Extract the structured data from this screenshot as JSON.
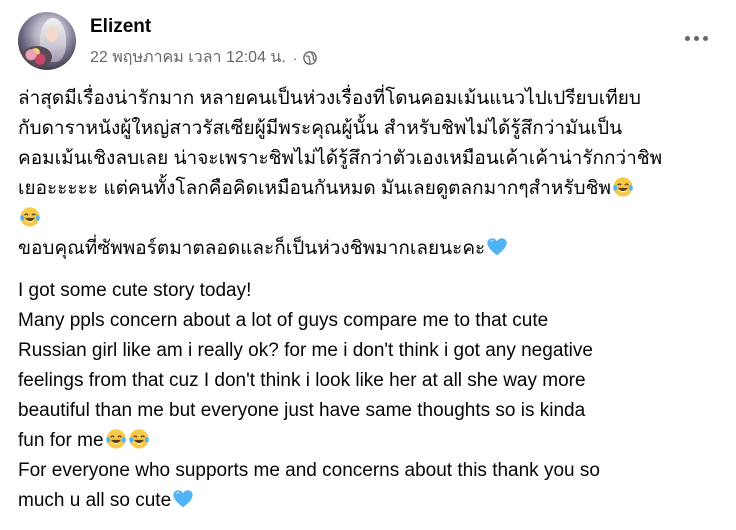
{
  "post": {
    "author": "Elizent",
    "timestamp": "22 พฤษภาคม เวลา 12:04 น.",
    "separator": "·",
    "privacy_icon": "globe-icon",
    "more_icon": "more-horizontal-icon"
  },
  "body": {
    "thai_lines": [
      "ล่าสุดมีเรื่องน่ารักมาก หลายคนเป็นห่วงเรื่องที่โดนคอมเม้นแนวไปเปรียบเทียบ",
      "กับดาราหนังผู้ใหญ่สาวรัสเซียผู้มีพระคุณผู้นั้น สำหรับชิพไม่ได้รู้สึกว่ามันเป็น",
      "คอมเม้นเชิงลบเลย น่าจะเพราะชิพไม่ได้รู้สึกว่าตัวเองเหมือนเค้าเค้าน่ารักกว่าชิพ",
      "เยอะะะะะ แต่คนทั้งโลกคือคิดเหมือนกันหมด มันเลยดูตลกมากๆสำหรับชิพ",
      "",
      "ขอบคุณที่ซัพพอร์ตมาตลอดและก็เป็นห่วงชิพมากเลยนะคะ"
    ],
    "english_lines": [
      "I got some cute story today!",
      "Many ppls concern about a lot of guys compare me to that cute",
      "Russian girl like am i really ok? for me i don't think i got any negative",
      "feelings from that cuz I don't think i look like her at all she way more",
      "beautiful than me but everyone just have same thoughts so is kinda",
      "fun for me",
      "For everyone who supports me and concerns about this thank you so",
      "much u all so cute"
    ]
  },
  "emoji_names": {
    "laugh": "face-with-tears-of-joy-emoji",
    "heart": "blue-heart-emoji"
  },
  "colors": {
    "text": "#050505",
    "secondary": "#65676b",
    "emoji_yellow": "#f7c948",
    "emoji_blue": "#4fb3f6"
  }
}
